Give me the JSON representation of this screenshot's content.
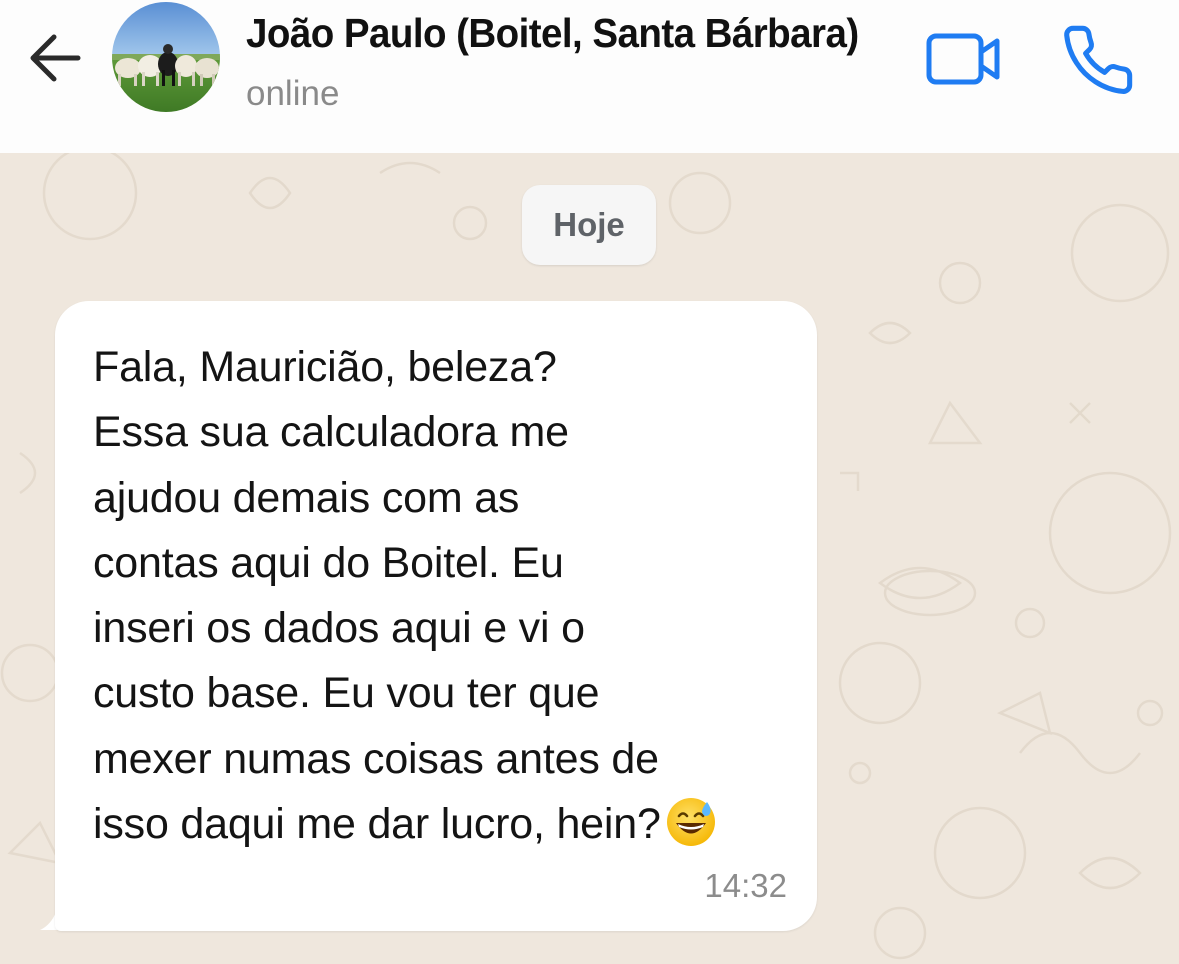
{
  "header": {
    "contact_name": "João Paulo (Boitel, Santa Bárbara)",
    "status": "online",
    "accent_color": "#1f7cf2",
    "icons": {
      "back": "arrow-left-icon",
      "video": "video-camera-icon",
      "call": "phone-icon"
    }
  },
  "chat": {
    "date_divider": "Hoje",
    "messages": [
      {
        "direction": "incoming",
        "lines": [
          "Fala, Mauricião, beleza?",
          "Essa sua calculadora me",
          "ajudou demais com as",
          "contas aqui do Boitel. Eu",
          "inseri os dados aqui e vi o",
          "custo base. Eu vou ter que",
          "mexer numas coisas antes de",
          "isso daqui me dar lucro, hein?"
        ],
        "emoji": "😅",
        "time": "14:32"
      }
    ]
  }
}
